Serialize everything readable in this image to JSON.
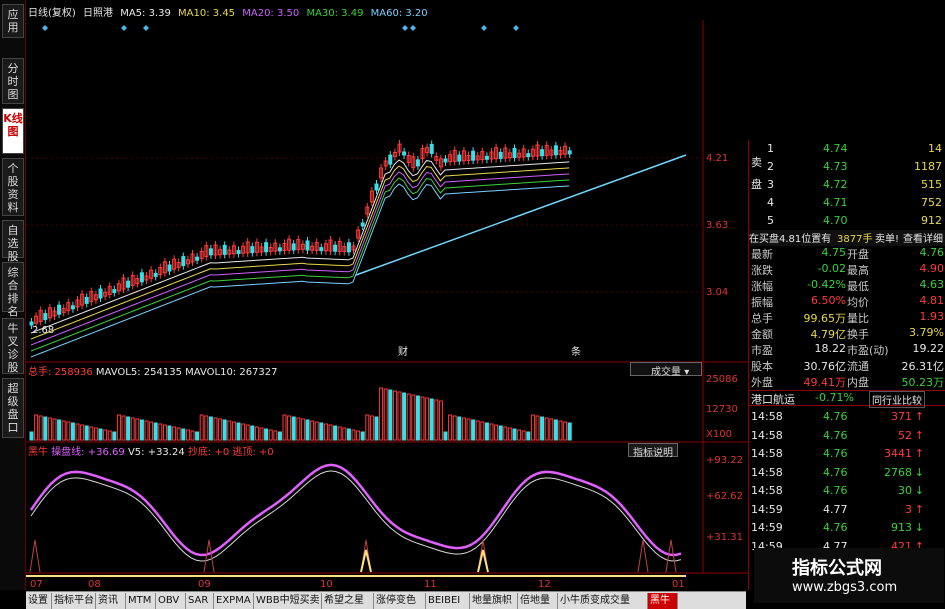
{
  "left_tabs": [
    "应用",
    "分时图",
    "K线图",
    "个股资料",
    "自选股",
    "综合排名",
    "牛叉诊股",
    "超级盘口"
  ],
  "active_left_tab": "K线图",
  "ma_bar": {
    "period": "日线(复权)",
    "name": "日照港",
    "ma5": "MA5: 3.39",
    "ma10": "MA10: 3.45",
    "ma20": "MA20: 3.50",
    "ma30": "MA30: 3.49",
    "ma60": "MA60: 3.20"
  },
  "price_axis": [
    "4.21",
    "3.63",
    "3.04"
  ],
  "low_label": "2.68",
  "chart_markers": [
    "财",
    "条"
  ],
  "volume_bar": {
    "total": "总手: 258936",
    "mavol5": "MAVOL5: 254135",
    "mavol10": "MAVOL10: 267327",
    "selector": "成交量"
  },
  "volume_axis": [
    "25086",
    "12730",
    "X100"
  ],
  "indicator_bar": {
    "name": "黑牛",
    "line1": "操盘线: +36.69",
    "v5": "V5: +33.24",
    "dip": "抄底: +0",
    "escape": "逃顶: +0",
    "button": "指标说明"
  },
  "indicator_axis": [
    "+93.22",
    "+62.62",
    "+31.31"
  ],
  "month_ticks": [
    "07",
    "08",
    "09",
    "10",
    "11",
    "12",
    "01"
  ],
  "colors": {
    "up": "#ff3b3b",
    "down": "#36e0e8",
    "accent": "#c00000"
  },
  "order_book": {
    "sell_label": "卖盘",
    "rows": [
      {
        "level": "1",
        "price": "4.74",
        "vol": "14"
      },
      {
        "level": "2",
        "price": "4.73",
        "vol": "1187"
      },
      {
        "level": "3",
        "price": "4.72",
        "vol": "515"
      },
      {
        "level": "4",
        "price": "4.71",
        "vol": "752"
      },
      {
        "level": "5",
        "price": "4.70",
        "vol": "912"
      }
    ]
  },
  "order_info": {
    "left": "在买盘4.81位置有",
    "mid": "3877手",
    "right": "卖单!",
    "link": "查看详细"
  },
  "stats": [
    {
      "k1": "最新",
      "v1": "4.75",
      "c1": "green",
      "k2": "开盘",
      "v2": "4.76",
      "c2": "green"
    },
    {
      "k1": "涨跌",
      "v1": "-0.02",
      "c1": "green",
      "k2": "最高",
      "v2": "4.90",
      "c2": "red"
    },
    {
      "k1": "涨幅",
      "v1": "-0.42%",
      "c1": "green",
      "k2": "最低",
      "v2": "4.63",
      "c2": "green"
    },
    {
      "k1": "振幅",
      "v1": "6.50%",
      "c1": "red",
      "k2": "均价",
      "v2": "4.81",
      "c2": "red"
    },
    {
      "k1": "总手",
      "v1": "99.65万",
      "c1": "yellow",
      "k2": "量比",
      "v2": "1.93",
      "c2": "red"
    },
    {
      "k1": "金额",
      "v1": "4.79亿",
      "c1": "yellow",
      "k2": "换手",
      "v2": "3.79%",
      "c2": "yellow"
    },
    {
      "k1": "市盈",
      "v1": "18.22",
      "c1": "white",
      "k2": "市盈(动)",
      "v2": "19.22",
      "c2": "white"
    },
    {
      "k1": "股本",
      "v1": "30.76亿",
      "c1": "white",
      "k2": "流通",
      "v2": "26.31亿",
      "c2": "white"
    },
    {
      "k1": "外盘",
      "v1": "49.41万",
      "c1": "red",
      "k2": "内盘",
      "v2": "50.23万",
      "c2": "green"
    }
  ],
  "sector": {
    "name": "港口航运",
    "change": "-0.71%",
    "button": "同行业比较"
  },
  "ticks": [
    {
      "time": "14:58",
      "price": "4.76",
      "vol": "371",
      "dir": "up"
    },
    {
      "time": "14:58",
      "price": "4.76",
      "vol": "52",
      "dir": "up"
    },
    {
      "time": "14:58",
      "price": "4.76",
      "vol": "3441",
      "dir": "up"
    },
    {
      "time": "14:58",
      "price": "4.76",
      "vol": "2768",
      "dir": "down"
    },
    {
      "time": "14:58",
      "price": "4.76",
      "vol": "30",
      "dir": "down"
    },
    {
      "time": "14:59",
      "price": "4.77",
      "vol": "3",
      "dir": "up"
    },
    {
      "time": "14:59",
      "price": "4.76",
      "vol": "913",
      "dir": "down"
    },
    {
      "time": "14:59",
      "price": "4.77",
      "vol": "421",
      "dir": "up"
    }
  ],
  "bottom_tabs": [
    "设置",
    "指标平台",
    "资讯",
    "MTM",
    "OBV",
    "SAR",
    "EXPMA",
    "WBB中短买卖",
    "希望之星",
    "涨停变色",
    "BEIBEI",
    "地量旗帜",
    "倍地量",
    "小牛质变成交量",
    "黑牛"
  ],
  "active_bottom_tab": "黑牛",
  "watermark": {
    "title": "指标公式网",
    "url": "www.zbgs3.com"
  }
}
